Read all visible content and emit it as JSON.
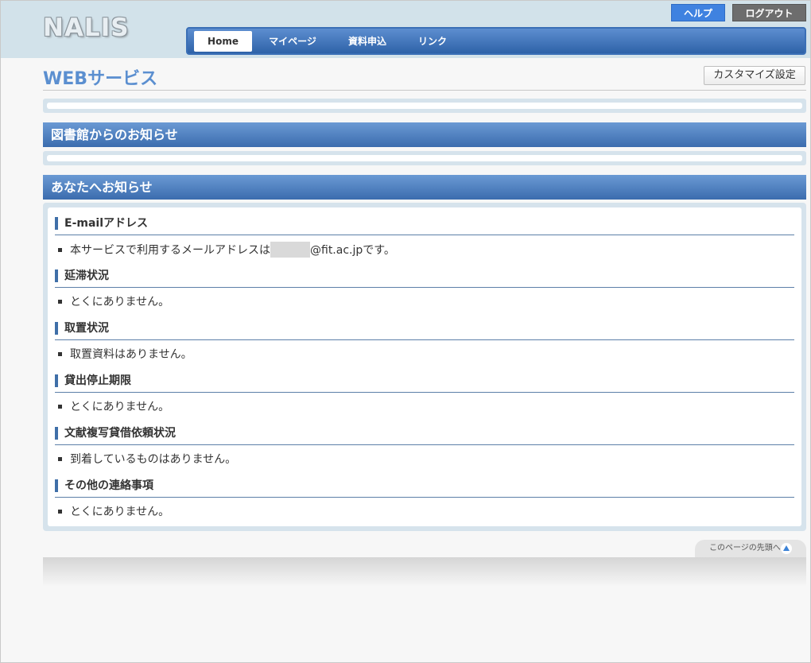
{
  "header": {
    "logo": "NALIS",
    "help_label": "ヘルプ",
    "logout_label": "ログアウト"
  },
  "nav": {
    "items": [
      {
        "label": "Home",
        "active": true
      },
      {
        "label": "マイページ"
      },
      {
        "label": "資料申込"
      },
      {
        "label": "リンク"
      }
    ]
  },
  "page": {
    "title": "WEBサービス",
    "customize_label": "カスタマイズ設定"
  },
  "sections": {
    "library_news": "図書館からのお知らせ",
    "your_news": "あなたへお知らせ"
  },
  "notices": [
    {
      "heading": "E-mailアドレス",
      "text_before": "本サービスで利用するメールアドレスは",
      "text_after": "@fit.ac.jpです。"
    },
    {
      "heading": "延滞状況",
      "text": "とくにありません。"
    },
    {
      "heading": "取置状況",
      "text": "取置資料はありません。"
    },
    {
      "heading": "貸出停止期限",
      "text": "とくにありません。"
    },
    {
      "heading": "文献複写貸借依頼状況",
      "text": "到着しているものはありません。"
    },
    {
      "heading": "その他の連絡事項",
      "text": "とくにありません。"
    }
  ],
  "footer": {
    "pagetop_label": "このページの先頭へ"
  }
}
